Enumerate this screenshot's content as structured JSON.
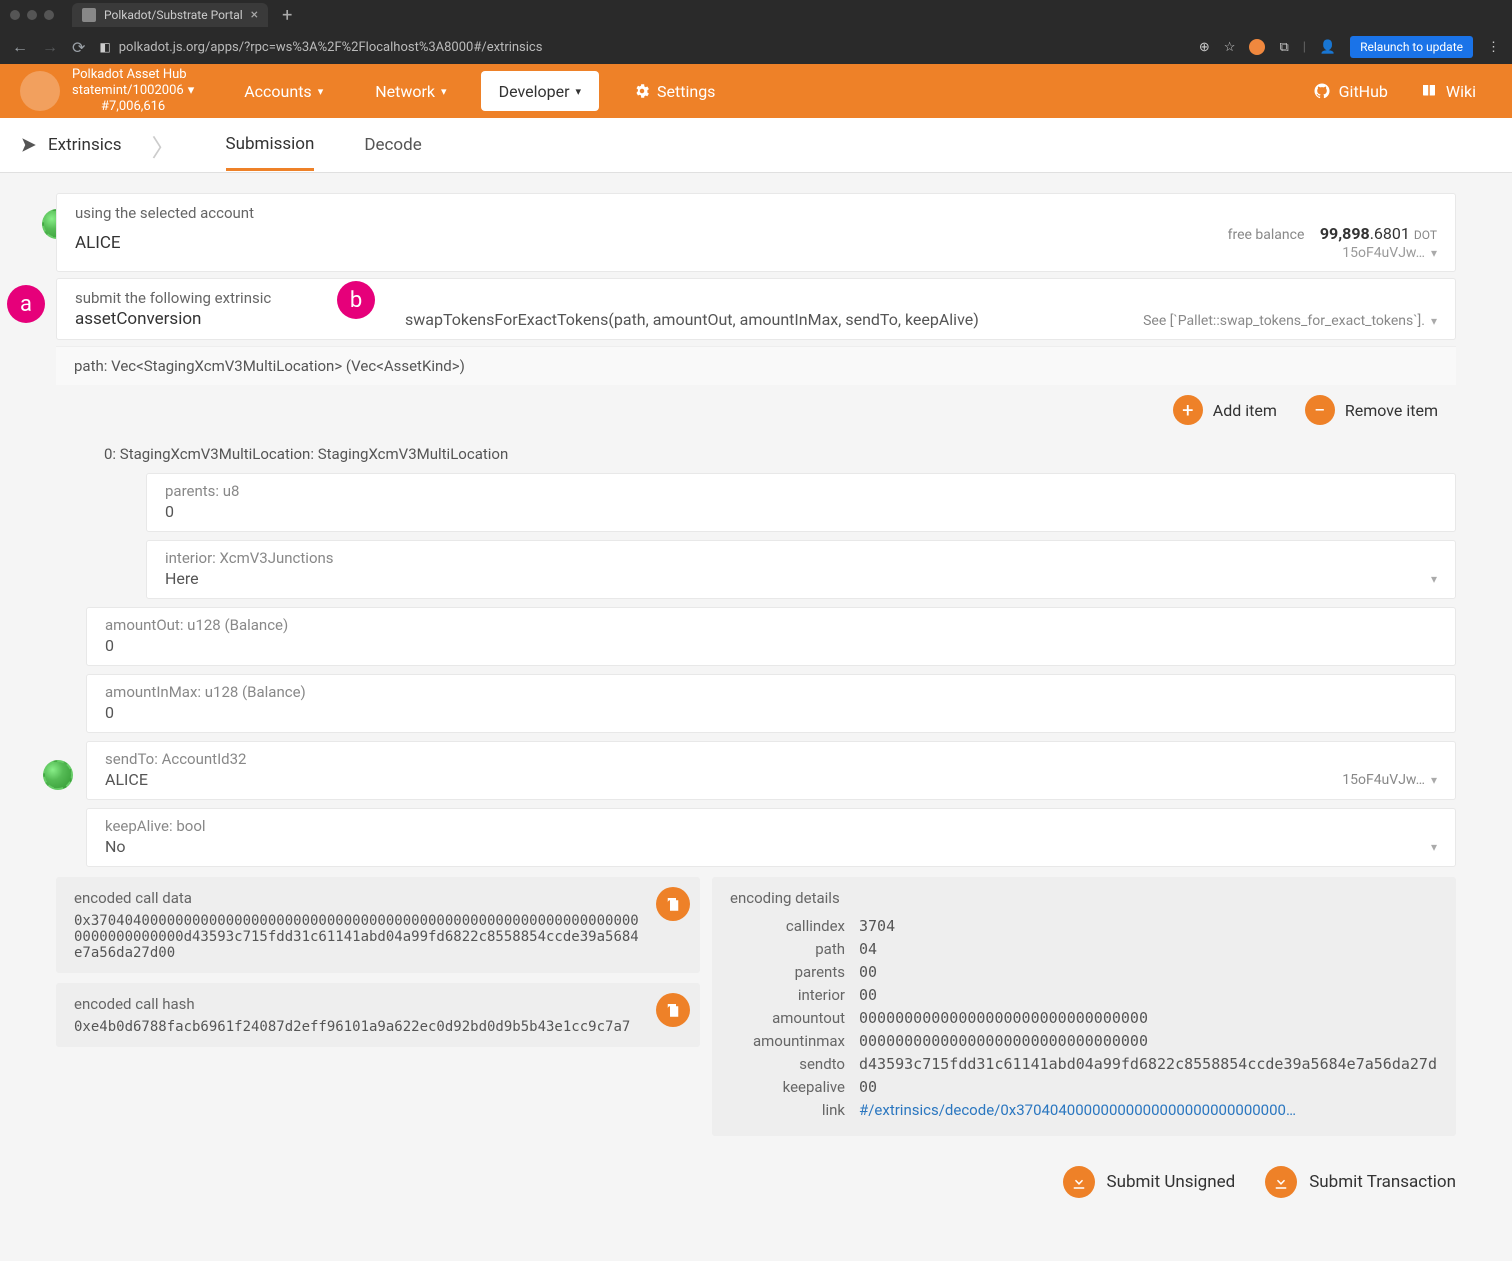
{
  "browser": {
    "tab_title": "Polkadot/Substrate Portal",
    "url": "polkadot.js.org/apps/?rpc=ws%3A%2F%2Flocalhost%3A8000#/extrinsics",
    "relaunch": "Relaunch to update"
  },
  "header": {
    "chain_name": "Polkadot Asset Hub",
    "chain_spec": "statemint/1002006",
    "chain_block": "#7,006,616",
    "nav": {
      "accounts": "Accounts",
      "network": "Network",
      "developer": "Developer",
      "settings": "Settings"
    },
    "github": "GitHub",
    "wiki": "Wiki"
  },
  "subnav": {
    "title": "Extrinsics",
    "submission": "Submission",
    "decode": "Decode"
  },
  "markers": {
    "a": "a",
    "b": "b"
  },
  "account": {
    "label": "using the selected account",
    "name": "ALICE",
    "balance_label": "free balance",
    "balance_int": "99,898",
    "balance_frac": ".6801",
    "balance_unit": "DOT",
    "addr_short": "15oF4uVJw…"
  },
  "extrinsic": {
    "label": "submit the following extrinsic",
    "pallet": "assetConversion",
    "method": "swapTokensForExactTokens(path, amountOut, amountInMax, sendTo, keepAlive)",
    "doc": "See [`Pallet::swap_tokens_for_exact_tokens`]."
  },
  "params": {
    "path_label": "path: Vec<StagingXcmV3MultiLocation> (Vec<AssetKind>)",
    "add_item": "Add item",
    "remove_item": "Remove item",
    "item0_label": "0: StagingXcmV3MultiLocation: StagingXcmV3MultiLocation",
    "parents_label": "parents: u8",
    "parents_value": "0",
    "interior_label": "interior: XcmV3Junctions",
    "interior_value": "Here",
    "amountOut_label": "amountOut: u128 (Balance)",
    "amountOut_value": "0",
    "amountInMax_label": "amountInMax: u128 (Balance)",
    "amountInMax_value": "0",
    "sendTo_label": "sendTo: AccountId32",
    "sendTo_value": "ALICE",
    "sendTo_addr": "15oF4uVJw…",
    "keepAlive_label": "keepAlive: bool",
    "keepAlive_value": "No"
  },
  "encoded": {
    "calldata_label": "encoded call data",
    "calldata": "0x370404000000000000000000000000000000000000000000000000000000000000000000000000d43593c715fdd31c61141abd04a99fd6822c8558854ccde39a5684e7a56da27d00",
    "callhash_label": "encoded call hash",
    "callhash": "0xe4b0d6788facb6961f24087d2eff96101a9a622ec0d92bd0d9b5b43e1cc9c7a7"
  },
  "details": {
    "title": "encoding details",
    "rows": {
      "callindex": {
        "k": "callindex",
        "v": "3704"
      },
      "path": {
        "k": "path",
        "v": "04"
      },
      "parents": {
        "k": "parents",
        "v": "00"
      },
      "interior": {
        "k": "interior",
        "v": "00"
      },
      "amountout": {
        "k": "amountout",
        "v": "00000000000000000000000000000000"
      },
      "amountinmax": {
        "k": "amountinmax",
        "v": "00000000000000000000000000000000"
      },
      "sendto": {
        "k": "sendto",
        "v": "d43593c715fdd31c61141abd04a99fd6822c8558854ccde39a5684e7a56da27d"
      },
      "keepalive": {
        "k": "keepalive",
        "v": "00"
      },
      "link": {
        "k": "link",
        "v": "#/extrinsics/decode/0x37040400000000000000000000000000…"
      }
    }
  },
  "actions": {
    "unsigned": "Submit Unsigned",
    "signed": "Submit Transaction"
  }
}
